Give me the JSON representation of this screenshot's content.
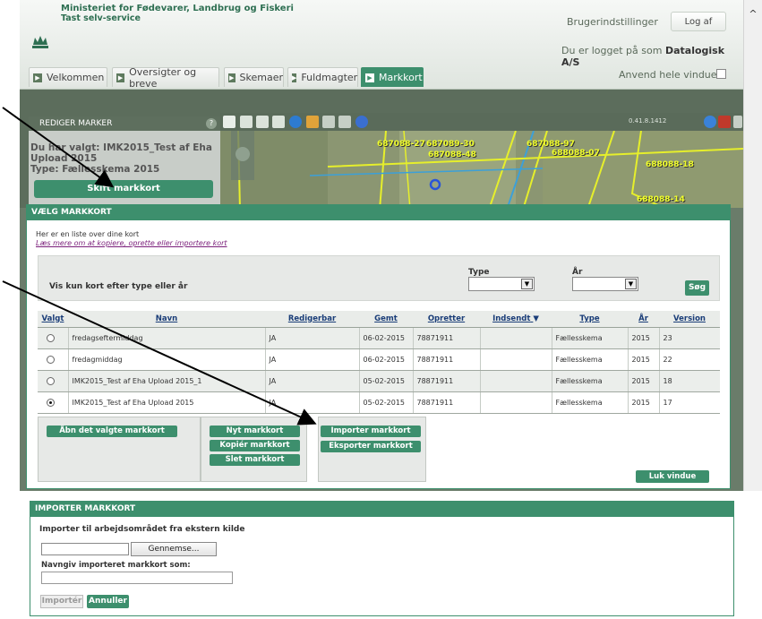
{
  "header": {
    "ministry": "Ministeriet for Fødevarer, Landbrug og Fiskeri",
    "ministry_sub": "Tast selv-service",
    "user_settings": "Brugerindstillinger",
    "logout": "Log af",
    "logged_in_prefix": "Du er logget på som ",
    "logged_in_user": "Datalogisk A/S",
    "full_window": "Anvend hele vinduet"
  },
  "tabs": [
    {
      "label": "Velkommen",
      "active": false
    },
    {
      "label": "Oversigter og breve",
      "active": false
    },
    {
      "label": "Skemaer",
      "active": false
    },
    {
      "label": "Fuldmagter",
      "active": false
    },
    {
      "label": "Markkort",
      "active": true
    }
  ],
  "side_panel": {
    "title": "REDIGER MARKER",
    "help": "?",
    "line1": "Du har valgt: IMK2015_Test af Eha",
    "line2": "Upload 2015",
    "line3": "Type: Fællesskema 2015",
    "switch_button": "Skift markkort"
  },
  "map": {
    "version": "0.41.8.1412",
    "plots": [
      "687089-30",
      "687088-48",
      "687088-27",
      "687088-97",
      "688088-07",
      "688088-18",
      "688088-14"
    ]
  },
  "velg_dialog": {
    "title": "VÆLG MARKKORT",
    "intro": "Her er en liste over dine kort",
    "link": "Læs mere om at kopiere, oprette eller importere kort",
    "filter_label": "Vis kun kort efter type eller år",
    "type_label": "Type",
    "year_label": "År",
    "search_button": "Søg",
    "columns": [
      "Valgt",
      "Navn",
      "Redigerbar",
      "Gemt",
      "Opretter",
      "Indsendt",
      "Type",
      "År",
      "Version"
    ],
    "rows": [
      {
        "name": "fredagseftermiddag",
        "editable": "JA",
        "saved": "06-02-2015",
        "creator": "78871911",
        "submitted": "",
        "type": "Fællesskema",
        "year": "2015",
        "version": "23",
        "selected": false
      },
      {
        "name": "fredagmiddag",
        "editable": "JA",
        "saved": "06-02-2015",
        "creator": "78871911",
        "submitted": "",
        "type": "Fællesskema",
        "year": "2015",
        "version": "22",
        "selected": false
      },
      {
        "name": "IMK2015_Test af Eha Upload 2015_1",
        "editable": "JA",
        "saved": "05-02-2015",
        "creator": "78871911",
        "submitted": "",
        "type": "Fællesskema",
        "year": "2015",
        "version": "18",
        "selected": false
      },
      {
        "name": "IMK2015_Test af Eha Upload 2015",
        "editable": "JA",
        "saved": "05-02-2015",
        "creator": "78871911",
        "submitted": "",
        "type": "Fællesskema",
        "year": "2015",
        "version": "17",
        "selected": true
      }
    ],
    "open_button": "Åbn det valgte markkort",
    "new_button": "Nyt markkort",
    "copy_button": "Kopiér markkort",
    "delete_button": "Slet markkort",
    "import_button": "Importer markkort",
    "export_button": "Eksporter markkort",
    "close_button": "Luk vindue"
  },
  "import_dialog": {
    "title": "IMPORTER MARKKORT",
    "subtitle": "Importer til arbejdsområdet fra ekstern kilde",
    "browse_button": "Gennemse...",
    "name_label": "Navngiv importeret markkort som:",
    "import_button": "Importér",
    "cancel_button": "Annuller"
  },
  "colors": {
    "accent": "#3d8f6d",
    "header_text": "#2e6f52",
    "map_label": "#f1ff2b"
  }
}
